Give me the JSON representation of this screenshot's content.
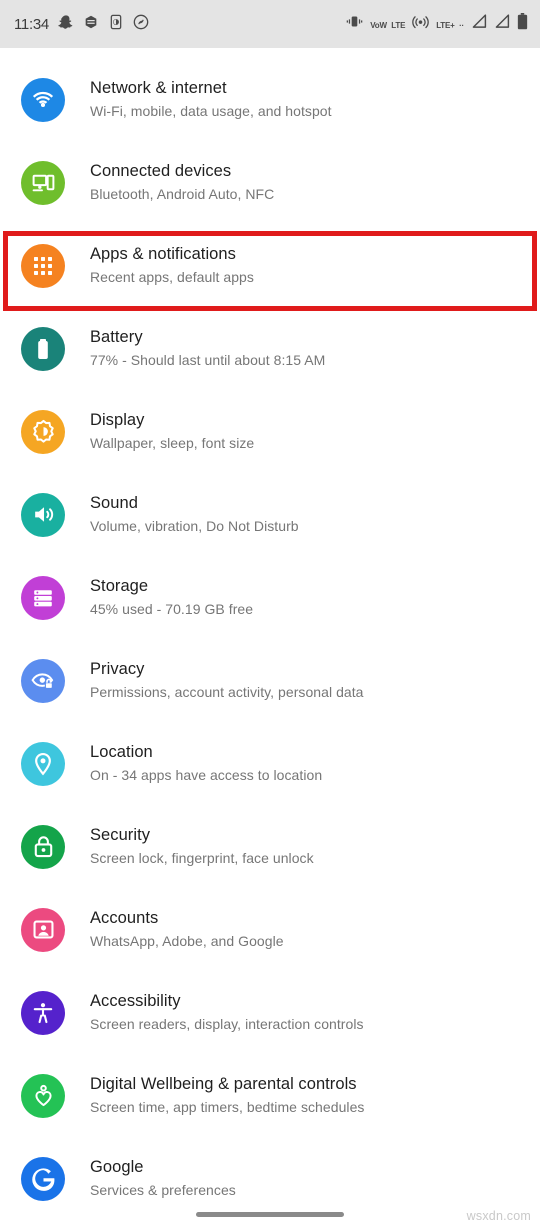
{
  "status_bar": {
    "clock": "11:34",
    "left_icons": [
      {
        "name": "snapchat-icon"
      },
      {
        "name": "hexagon-app-icon"
      },
      {
        "name": "phone-app-icon"
      },
      {
        "name": "shazam-icon"
      }
    ],
    "right_icons": [
      {
        "name": "vibrate-icon"
      },
      {
        "name": "volte-icon",
        "line1": "VoW",
        "line2": "LTE"
      },
      {
        "name": "hotspot-icon"
      },
      {
        "name": "lte-plus-icon",
        "line1": "LTE+",
        "line2": "··"
      },
      {
        "name": "signal-bars-sim1-icon"
      },
      {
        "name": "signal-bars-sim2-icon"
      },
      {
        "name": "battery-icon"
      }
    ],
    "background": "#e4e4e4"
  },
  "highlight": {
    "color": "#e01b1b",
    "target": "Apps & notifications"
  },
  "settings": {
    "items": [
      {
        "icon": "wifi-icon",
        "color": "#1e88e5",
        "title": "Network & internet",
        "subtitle": "Wi-Fi, mobile, data usage, and hotspot"
      },
      {
        "icon": "connected-devices-icon",
        "color": "#6fbe2c",
        "title": "Connected devices",
        "subtitle": "Bluetooth, Android Auto, NFC"
      },
      {
        "icon": "apps-grid-icon",
        "color": "#f58220",
        "title": "Apps & notifications",
        "subtitle": "Recent apps, default apps"
      },
      {
        "icon": "battery-icon",
        "color": "#1a8379",
        "title": "Battery",
        "subtitle": "77% - Should last until about 8:15 AM"
      },
      {
        "icon": "brightness-icon",
        "color": "#f5a623",
        "title": "Display",
        "subtitle": "Wallpaper, sleep, font size"
      },
      {
        "icon": "sound-icon",
        "color": "#19b0a0",
        "title": "Sound",
        "subtitle": "Volume, vibration, Do Not Disturb"
      },
      {
        "icon": "storage-icon",
        "color": "#c13fd6",
        "title": "Storage",
        "subtitle": "45% used - 70.19 GB free"
      },
      {
        "icon": "privacy-eye-lock-icon",
        "color": "#5b8def",
        "title": "Privacy",
        "subtitle": "Permissions, account activity, personal data"
      },
      {
        "icon": "location-pin-icon",
        "color": "#3ec6de",
        "title": "Location",
        "subtitle": "On - 34 apps have access to location"
      },
      {
        "icon": "lock-icon",
        "color": "#14a44a",
        "title": "Security",
        "subtitle": "Screen lock, fingerprint, face unlock"
      },
      {
        "icon": "account-badge-icon",
        "color": "#ec4a80",
        "title": "Accounts",
        "subtitle": "WhatsApp, Adobe, and Google"
      },
      {
        "icon": "accessibility-icon",
        "color": "#5522cc",
        "title": "Accessibility",
        "subtitle": "Screen readers, display, interaction controls"
      },
      {
        "icon": "wellbeing-heart-icon",
        "color": "#24c255",
        "title": "Digital Wellbeing & parental controls",
        "subtitle": "Screen time, app timers, bedtime schedules"
      },
      {
        "icon": "google-g-icon",
        "color": "#1a73e8",
        "title": "Google",
        "subtitle": "Services & preferences"
      }
    ]
  },
  "footer": {
    "watermark": "wsxdn.com"
  }
}
